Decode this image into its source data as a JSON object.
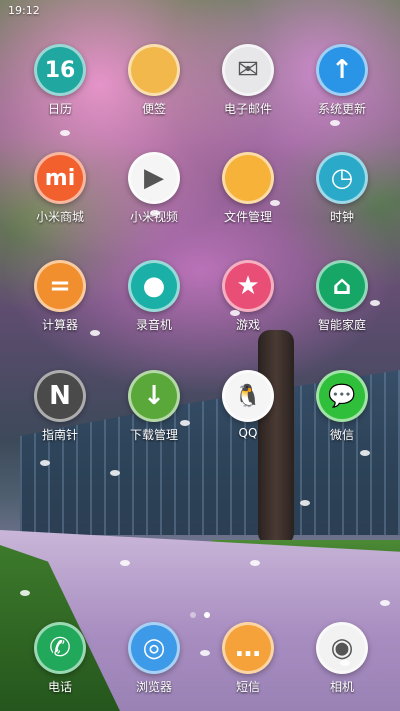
{
  "statusbar": {
    "time": "19:12"
  },
  "apps": [
    {
      "id": "calendar",
      "label": "日历",
      "icon": "calendar-icon",
      "glyph": "16",
      "color": "#1fa7a0"
    },
    {
      "id": "notes",
      "label": "便签",
      "icon": "notes-icon",
      "glyph": "",
      "color": "#f2b84b"
    },
    {
      "id": "mail",
      "label": "电子邮件",
      "icon": "mail-icon",
      "glyph": "✉",
      "color": "#e7e7ea"
    },
    {
      "id": "update",
      "label": "系统更新",
      "icon": "update-icon",
      "glyph": "↑",
      "color": "#2a95e6"
    },
    {
      "id": "mi-store",
      "label": "小米商城",
      "icon": "mi-store-icon",
      "glyph": "mi",
      "color": "#f2602e"
    },
    {
      "id": "mi-video",
      "label": "小米视频",
      "icon": "video-icon",
      "glyph": "▶",
      "color": "#f5f5f5"
    },
    {
      "id": "files",
      "label": "文件管理",
      "icon": "folder-icon",
      "glyph": "",
      "color": "#f7b23a"
    },
    {
      "id": "clock",
      "label": "时钟",
      "icon": "clock-icon",
      "glyph": "◷",
      "color": "#2aa9c9"
    },
    {
      "id": "calculator",
      "label": "计算器",
      "icon": "calculator-icon",
      "glyph": "=",
      "color": "#f18e2e"
    },
    {
      "id": "recorder",
      "label": "录音机",
      "icon": "recorder-icon",
      "glyph": "●",
      "color": "#1ab0a8"
    },
    {
      "id": "games",
      "label": "游戏",
      "icon": "games-icon",
      "glyph": "★",
      "color": "#e94e77"
    },
    {
      "id": "smarthome",
      "label": "智能家庭",
      "icon": "smarthome-icon",
      "glyph": "⌂",
      "color": "#16a767"
    },
    {
      "id": "compass",
      "label": "指南针",
      "icon": "compass-icon",
      "glyph": "N",
      "color": "#4a4a4a"
    },
    {
      "id": "downloads",
      "label": "下载管理",
      "icon": "download-icon",
      "glyph": "↓",
      "color": "#5aa83a"
    },
    {
      "id": "qq",
      "label": "QQ",
      "icon": "qq-icon",
      "glyph": "🐧",
      "color": "#f5f5f5"
    },
    {
      "id": "wechat",
      "label": "微信",
      "icon": "wechat-icon",
      "glyph": "💬",
      "color": "#2fbf3a"
    }
  ],
  "dock": [
    {
      "id": "phone",
      "label": "电话",
      "icon": "phone-icon",
      "glyph": "✆",
      "color": "#22a85a"
    },
    {
      "id": "browser",
      "label": "浏览器",
      "icon": "browser-icon",
      "glyph": "◎",
      "color": "#3d9ae8"
    },
    {
      "id": "messages",
      "label": "短信",
      "icon": "messages-icon",
      "glyph": "…",
      "color": "#f5a23a"
    },
    {
      "id": "camera",
      "label": "相机",
      "icon": "camera-icon",
      "glyph": "◉",
      "color": "#f2f2f2"
    }
  ],
  "page_indicator": {
    "pages": 2,
    "active": 1
  }
}
